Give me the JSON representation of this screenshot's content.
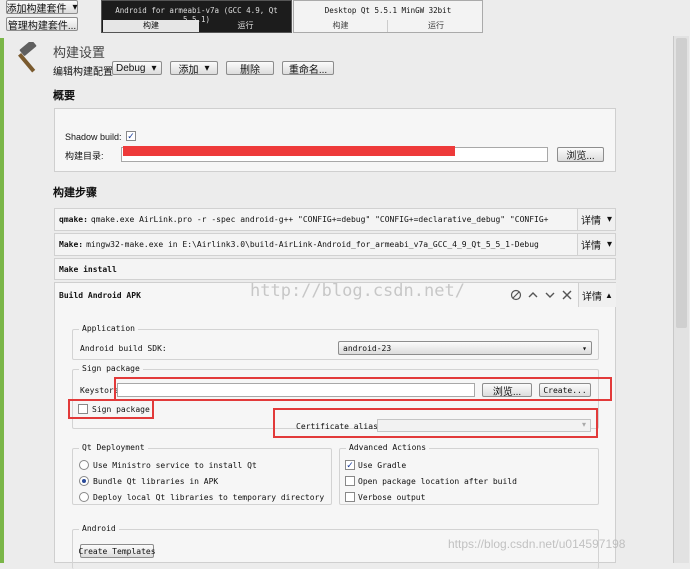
{
  "kits": {
    "add_kit": "添加构建套件",
    "manage_kits": "管理构建套件..."
  },
  "targets": [
    {
      "title": "Android for armeabi-v7a (GCC 4.9, Qt 5.5.1)",
      "build": "构建",
      "run": "运行"
    },
    {
      "title": "Desktop Qt 5.5.1 MinGW 32bit",
      "build": "构建",
      "run": "运行"
    }
  ],
  "header": {
    "title": "构建设置",
    "config_label": "编辑构建配置:",
    "config_value": "Debug",
    "add": "添加",
    "delete": "删除",
    "rename": "重命名..."
  },
  "overview": {
    "heading": "概要",
    "shadow_label": "Shadow build:",
    "shadow_checked": "✓",
    "dir_label": "构建目录:",
    "browse": "浏览..."
  },
  "steps": {
    "heading": "构建步骤",
    "items": [
      {
        "name": "qmake:",
        "cmd": "qmake.exe AirLink.pro -r -spec android-g++ \"CONFIG+=debug\" \"CONFIG+=declarative_debug\" \"CONFIG+",
        "details": "详情"
      },
      {
        "name": "Make:",
        "cmd": "mingw32-make.exe in E:\\Airlink3.0\\build-AirLink-Android_for_armeabi_v7a_GCC_4_9_Qt_5_5_1-Debug",
        "details": "详情"
      },
      {
        "name": "Make install",
        "cmd": "",
        "details": ""
      }
    ],
    "apk": {
      "name": "Build Android APK",
      "details": "详情"
    }
  },
  "apk": {
    "application": {
      "title": "Application",
      "sdk_label": "Android build SDK:",
      "sdk_value": "android-23"
    },
    "sign": {
      "title": "Sign package",
      "keystore_label": "Keystore:",
      "browse": "浏览...",
      "create": "Create...",
      "sign_checkbox": "Sign package",
      "alias_label": "Certificate alias:"
    },
    "deploy": {
      "title": "Qt Deployment",
      "options": [
        "Use Ministro service to install Qt",
        "Bundle Qt libraries in APK",
        "Deploy local Qt libraries to temporary directory"
      ]
    },
    "advanced": {
      "title": "Advanced Actions",
      "options": [
        "Use Gradle",
        "Open package location after build",
        "Verbose output"
      ]
    },
    "android": {
      "title": "Android",
      "create_templates": "Create Templates"
    }
  },
  "watermarks": {
    "center": "http://blog.csdn.net/",
    "corner": "https://blog.csdn.net/u014597198"
  },
  "colors": {
    "accent": "#e23a3a",
    "tab_active": "#1c1c1c",
    "panel": "#f6f6f6"
  }
}
